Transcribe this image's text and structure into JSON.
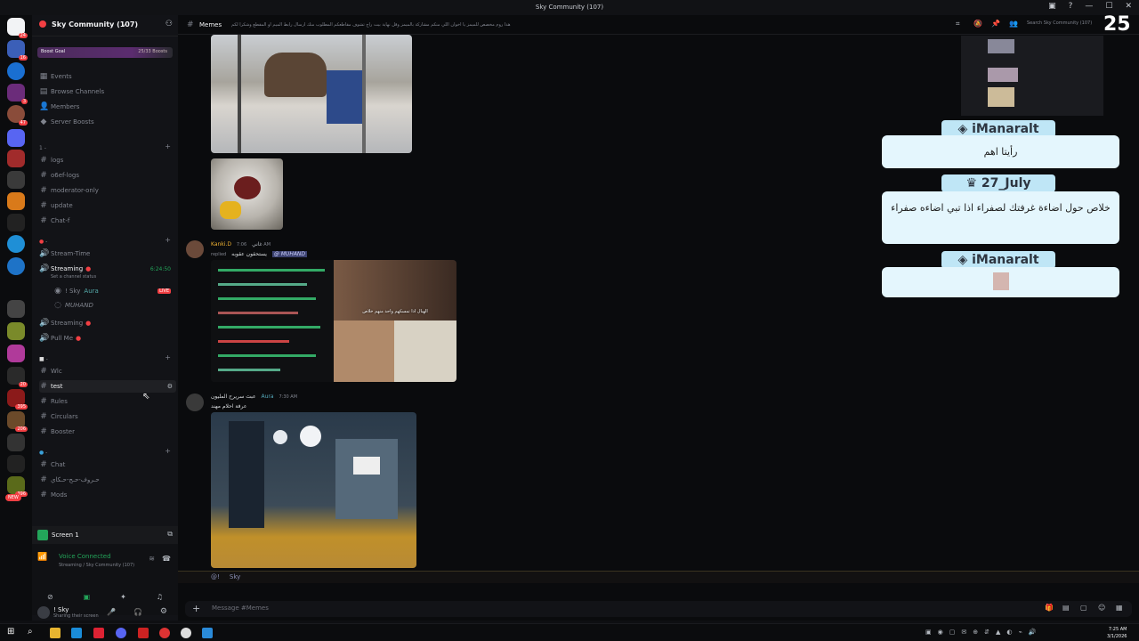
{
  "window": {
    "title": "Sky Community (107)",
    "controls": [
      "—",
      "☐",
      "✕"
    ]
  },
  "rail": {
    "badges": [
      "24",
      "16",
      "3",
      "47",
      "396",
      "20",
      "395",
      "206",
      "396",
      "NEW"
    ]
  },
  "server": {
    "name": "Sky Community (107)",
    "boost_goal": "Boost Goal",
    "boost_progress": "25/33 Boosts",
    "boost_fraction": 0.76
  },
  "nav": [
    {
      "icon": "▦",
      "label": "Events"
    },
    {
      "icon": "▤",
      "label": "Browse Channels"
    },
    {
      "icon": "👤",
      "label": "Members"
    },
    {
      "icon": "◆",
      "label": "Server Boosts"
    }
  ],
  "cat1": "1 -",
  "channels1": [
    "logs",
    "o6ef-logs",
    "moderator-only",
    "update",
    "Chat-f"
  ],
  "cat2": "-",
  "channels2": [
    {
      "label": "Stream-Time"
    },
    {
      "label": "Streaming",
      "time": "6:24:50"
    }
  ],
  "channel_status": "Set a channel status",
  "voice_users": [
    "! Sky",
    "MUHAND"
  ],
  "voice_user_tag": "Aura",
  "live_label": "LIVE",
  "voice2": [
    "Streaming",
    "Pull Me"
  ],
  "cat3": "-",
  "channels3": [
    "Wlc",
    "test",
    "Rules",
    "Circulars",
    "Booster"
  ],
  "cat4": "-",
  "channels4": [
    "Chat",
    "حـروف-حـح-حـكاي",
    "Mods"
  ],
  "screen": {
    "label": "Screen 1"
  },
  "voice": {
    "status": "Voice Connected",
    "detail": "Streaming / Sky Community (107)"
  },
  "user": {
    "name": "! Sky",
    "status": "Sharing their screen"
  },
  "header": {
    "channel": "Memes",
    "topic": "هذا روم مخصص للميمز يا اخوان اللي منكم مشاركة بالميمز وقل نهاية بيت راح تشوف مقاطعكم المطلوب منك ارسال رابط الميم او المقطع وشكرا لكم",
    "search": "Search Sky Community (107)"
  },
  "messages": [
    {
      "author": "Kanki.D",
      "tag": "غاني",
      "time": "7:06 AM",
      "reply": "replied",
      "reply_text": "يستحقون عقوبه",
      "mention": "@ MUHAND"
    },
    {
      "author": "عبث سريرح المليون",
      "tag": "Aura",
      "time": "7:30 AM",
      "text": "عرفة احلام مهند"
    }
  ],
  "meme_caption": "الهبال اذا تمسكهم واحد منهم خلاص",
  "composer": {
    "placeholder": "Message #Memes",
    "typing": "@!     Sky"
  },
  "overlay": {
    "counter": "25",
    "user1": "iManaralt",
    "msg1": "رأيتا اهم",
    "user2": "27_July",
    "msg2": "خلاص حول اضاءة غرفتك لصفراء اذا تبي اضاءه صفراء",
    "user3": "iManaralt"
  },
  "clock": {
    "time": "7:25 AM",
    "date": "3/1/2026"
  }
}
